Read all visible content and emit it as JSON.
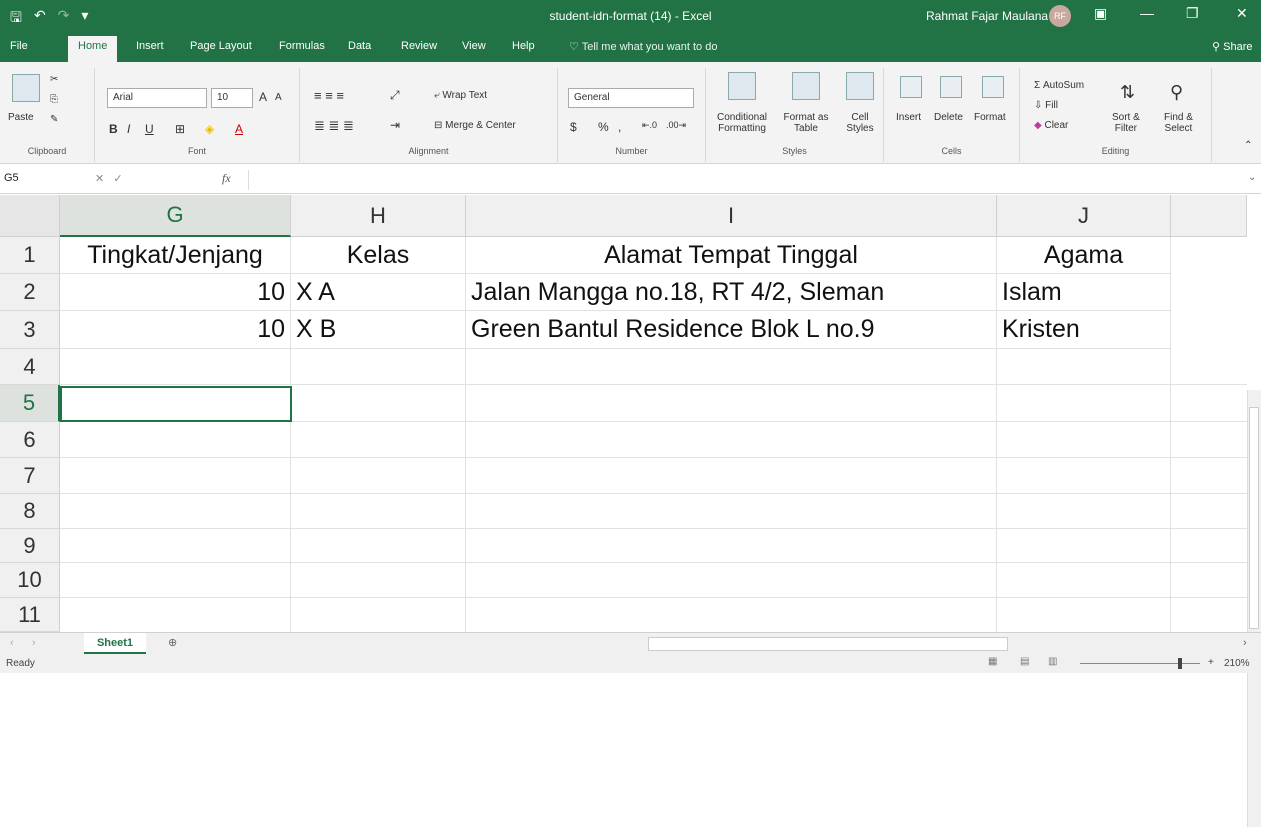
{
  "window": {
    "title": "student-idn-format (14)  -  Excel",
    "user": "Rahmat Fajar Maulana",
    "user_initials": "RF"
  },
  "tabs": [
    "File",
    "Home",
    "Insert",
    "Page Layout",
    "Formulas",
    "Data",
    "Review",
    "View",
    "Help"
  ],
  "tell_me": "Tell me what you want to do",
  "share": "Share",
  "ribbon": {
    "clipboard": {
      "paste": "Paste",
      "label": "Clipboard"
    },
    "font": {
      "name": "Arial",
      "size": "10",
      "label": "Font",
      "bold": "B",
      "italic": "I",
      "underline": "U"
    },
    "alignment": {
      "wrap": "Wrap Text",
      "merge": "Merge & Center",
      "label": "Alignment"
    },
    "number": {
      "format": "General",
      "percent": "%",
      "comma": ",",
      "label": "Number"
    },
    "styles": {
      "conditional": "Conditional",
      "conditional2": "Formatting",
      "format_as": "Format as",
      "format_as2": "Table",
      "cell": "Cell",
      "cell2": "Styles",
      "label": "Styles"
    },
    "cells": {
      "insert": "Insert",
      "delete": "Delete",
      "format": "Format",
      "label": "Cells"
    },
    "editing": {
      "autosum": "AutoSum",
      "fill": "Fill",
      "clear": "Clear",
      "sort": "Sort &",
      "sort2": "Filter",
      "find": "Find &",
      "find2": "Select",
      "label": "Editing"
    }
  },
  "formula_bar": {
    "name_box": "G5",
    "fx": "fx",
    "value": ""
  },
  "sheet": {
    "columns": [
      "G",
      "H",
      "I",
      "J"
    ],
    "selected_column": "G",
    "rows": [
      "1",
      "2",
      "3",
      "4",
      "5",
      "6",
      "7",
      "8",
      "9",
      "10",
      "11"
    ],
    "selected_row": "5",
    "cells": [
      [
        "Tingkat/Jenjang",
        "Kelas",
        "Alamat Tempat Tinggal",
        "Agama"
      ],
      [
        "10",
        "X A",
        "Jalan Mangga no.18, RT 4/2, Sleman",
        "Islam"
      ],
      [
        "10",
        "X B",
        "Green Bantul Residence Blok L no.9",
        "Kristen"
      ]
    ]
  },
  "sheet_tabs": [
    "Sheet1"
  ],
  "status": {
    "ready": "Ready",
    "zoom": "210%"
  }
}
